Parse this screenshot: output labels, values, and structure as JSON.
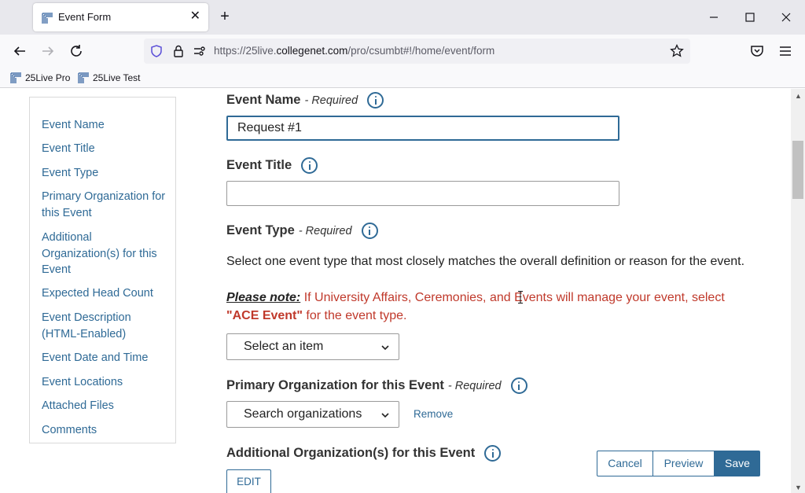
{
  "browser": {
    "tab_title": "Event Form",
    "tab_close": "✕",
    "new_tab": "+",
    "url_prefix": "https://25live.",
    "url_host": "collegenet.com",
    "url_path": "/pro/csumbt#!/home/event/form",
    "bookmarks": [
      {
        "label": "25Live Pro"
      },
      {
        "label": "25Live Test"
      }
    ]
  },
  "sidebar": {
    "items": [
      {
        "label": "Event Name"
      },
      {
        "label": "Event Title"
      },
      {
        "label": "Event Type"
      },
      {
        "label": "Primary Organization for this Event"
      },
      {
        "label": "Additional Organization(s) for this Event"
      },
      {
        "label": "Expected Head Count"
      },
      {
        "label": "Event Description (HTML-Enabled)"
      },
      {
        "label": "Event Date and Time"
      },
      {
        "label": "Event Locations"
      },
      {
        "label": "Attached Files"
      },
      {
        "label": "Comments"
      }
    ]
  },
  "form": {
    "event_name": {
      "label": "Event Name",
      "required": "- Required",
      "value": "Request #1"
    },
    "event_title": {
      "label": "Event Title",
      "value": ""
    },
    "event_type": {
      "label": "Event Type",
      "required": "- Required",
      "description": "Select one event type that most closely matches the overall definition or reason for the event.",
      "note_lead": "Please note:",
      "note_text": " If University Affairs, Ceremonies, and Events will manage your event, select ",
      "note_strong": "\"ACE Event\"",
      "note_tail": " for the event type.",
      "select_value": "Select an item"
    },
    "primary_org": {
      "label": "Primary Organization for this Event",
      "required": "- Required",
      "select_value": "Search organizations",
      "remove_label": "Remove"
    },
    "additional_org": {
      "label": "Additional Organization(s) for this Event",
      "edit_label": "EDIT"
    }
  },
  "actions": {
    "cancel": "Cancel",
    "preview": "Preview",
    "save": "Save"
  },
  "colors": {
    "link": "#2f6a96",
    "note_red": "#c0392b",
    "save_bg": "#2f6a96"
  }
}
